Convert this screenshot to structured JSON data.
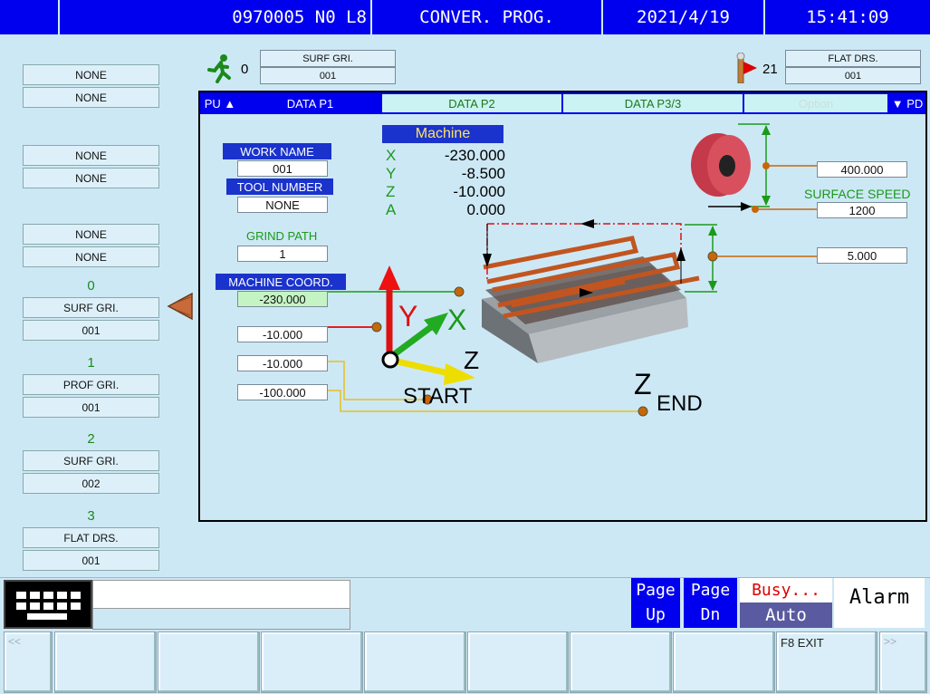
{
  "header": {
    "program": "0970005 N0 L8",
    "mode": "CONVER. PROG.",
    "date": "2021/4/19",
    "time": "15:41:09"
  },
  "top_left_indicator": {
    "count": "0",
    "label": "SURF GRI.",
    "value": "001"
  },
  "top_right_indicator": {
    "count": "21",
    "label": "FLAT DRS.",
    "value": "001"
  },
  "left_list": {
    "pairs": [
      {
        "a": "NONE",
        "b": "NONE"
      },
      {
        "a": "NONE",
        "b": "NONE"
      },
      {
        "a": "NONE",
        "b": "NONE"
      }
    ],
    "steps": [
      {
        "num": "0",
        "type": "SURF GRI.",
        "value": "001"
      },
      {
        "num": "1",
        "type": "PROF GRI.",
        "value": "001"
      },
      {
        "num": "2",
        "type": "SURF GRI.",
        "value": "002"
      },
      {
        "num": "3",
        "type": "FLAT DRS.",
        "value": "001"
      }
    ]
  },
  "tabs": {
    "pu": "PU ▲",
    "p1": "DATA P1",
    "p2": "DATA P2",
    "p3": "DATA P3/3",
    "option": "Option",
    "pd": "▼ PD"
  },
  "form": {
    "work_name_label": "WORK NAME",
    "work_name": "001",
    "tool_number_label": "TOOL NUMBER",
    "tool_number": "NONE",
    "grind_path_label": "GRIND PATH",
    "grind_path": "1",
    "machine_coord_label": "MACHINE COORD.",
    "machine_coord": "-230.000",
    "y_val": "-10.000",
    "z_val": "-10.000",
    "z_end_val": "-100.000"
  },
  "machine": {
    "title": "Machine",
    "axes": [
      {
        "axis": "X",
        "value": "-230.000"
      },
      {
        "axis": "Y",
        "value": "-8.500"
      },
      {
        "axis": "Z",
        "value": "-10.000"
      },
      {
        "axis": "A",
        "value": "0.000"
      }
    ]
  },
  "diagram": {
    "y_label": "Y",
    "x_label": "X",
    "z_label": "Z",
    "start_label": "START",
    "zend_z": "Z",
    "zend_sub": "END",
    "wheel_diameter": "400.000",
    "surface_speed_label": "SURFACE SPEED",
    "surface_speed": "1200",
    "depth": "5.000"
  },
  "bottom": {
    "page_up": [
      "Page",
      "Up"
    ],
    "page_dn": [
      "Page",
      "Dn"
    ],
    "busy": "Busy...",
    "auto": "Auto",
    "alarm": "Alarm",
    "prev": "<<",
    "next": ">>",
    "f8": "F8 EXIT"
  },
  "colors": {
    "header_blue": "#0000ee",
    "bg": "#cde8f5",
    "green_text": "#1a9a1a"
  }
}
